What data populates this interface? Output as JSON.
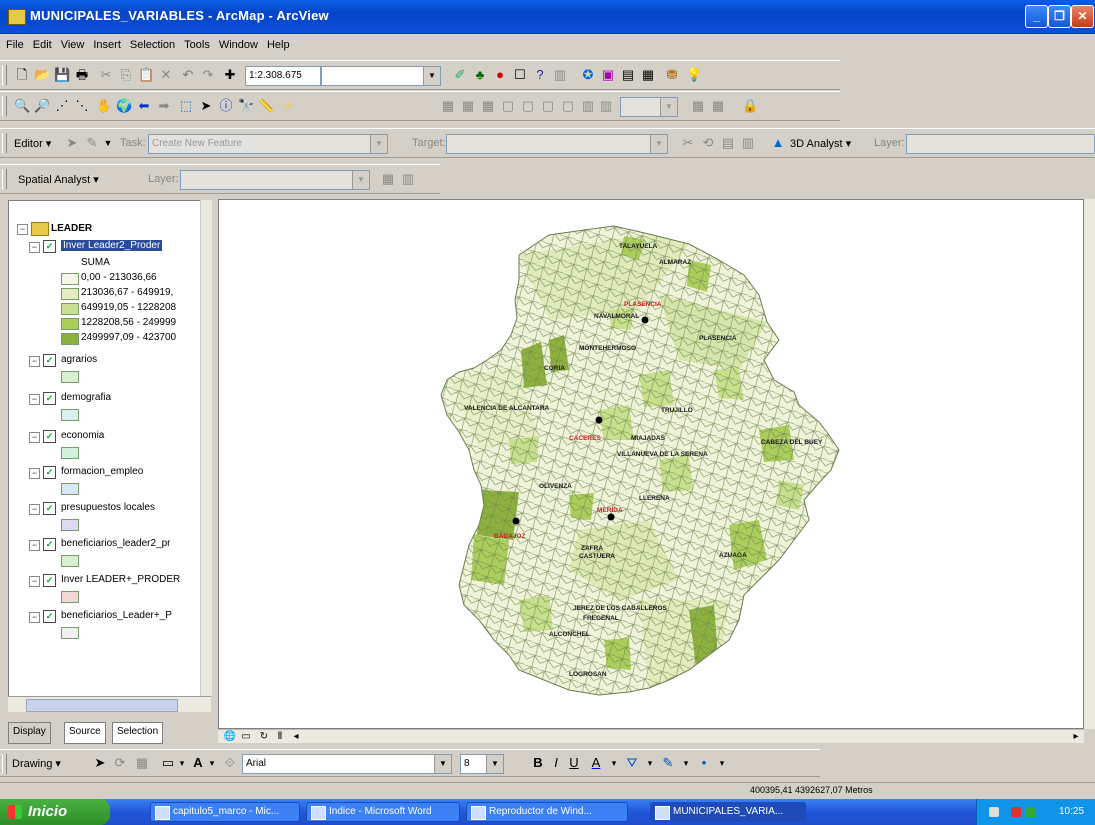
{
  "window": {
    "title": "MUNICIPALES_VARIABLES - ArcMap - ArcView"
  },
  "menu": [
    "File",
    "Edit",
    "View",
    "Insert",
    "Selection",
    "Tools",
    "Window",
    "Help"
  ],
  "toolbar": {
    "scale_value": "1:2.308.675"
  },
  "editor": {
    "editor_label": "Editor ▾",
    "task_label": "Task:",
    "task_value": "Create New Feature",
    "target_label": "Target:",
    "analyst_3d_label": "3D Analyst ▾",
    "layer_label": "Layer:"
  },
  "spatial_analyst": {
    "label": "Spatial Analyst ▾",
    "layer_label": "Layer:"
  },
  "toc": {
    "root": "LEADER",
    "layers": [
      {
        "name": "Inver Leader2_Proder",
        "selected": true,
        "field": "SUMA",
        "classes": [
          {
            "label": "0,00 - 213036,66",
            "color": "#f4f6e8"
          },
          {
            "label": "213036,67 - 649919,",
            "color": "#e3edc0"
          },
          {
            "label": "649919,05 - 1228208",
            "color": "#c8df8e"
          },
          {
            "label": "1228208,56 - 249999",
            "color": "#aacd5c"
          },
          {
            "label": "2499997,09 - 423700",
            "color": "#8db13e"
          }
        ]
      },
      {
        "name": "agrarios",
        "swatch": "#d8f0d0"
      },
      {
        "name": "demografia",
        "swatch": "#d8f0f0"
      },
      {
        "name": "economia",
        "swatch": "#d0f0e0"
      },
      {
        "name": "formacion_empleo",
        "swatch": "#d8e8f8"
      },
      {
        "name": "presupuestos locales",
        "swatch": "#e0d8f0"
      },
      {
        "name": "beneficiarios_leader2_pr",
        "swatch": "#d8f0d0"
      },
      {
        "name": "Inver LEADER+_PRODER",
        "swatch": "#f0d8d8"
      },
      {
        "name": "beneficiarios_Leader+_P",
        "swatch": "#f0f0f0"
      }
    ],
    "tabs": [
      "Display",
      "Source",
      "Selection"
    ]
  },
  "map": {
    "labels_black": [
      "ALMARAZ",
      "TALAYUELA",
      "PLASENCIA",
      "NAVALMORAL",
      "CORIA",
      "MONTEHERMOSO",
      "TRUJILLO",
      "LOGROSAN",
      "VILLANUEVA DE LA SERENA",
      "MIAJADAS",
      "ALCONCHEL",
      "LLERENA",
      "AZUAGA",
      "ZAFRA",
      "JEREZ DE LOS CABALLEROS",
      "FREGENAL",
      "OLIVENZA",
      "CASTUERA",
      "VALENCIA DE ALCANTARA",
      "CABEZA DEL BUEY"
    ],
    "labels_red": [
      "PLASENCIA",
      "CACERES",
      "BADAJOZ",
      "MERIDA"
    ]
  },
  "drawing": {
    "drawing_label": "Drawing ▾",
    "font_name": "Arial",
    "font_size": "8"
  },
  "status": {
    "coords": "400395,41  4392627,07 Metros"
  },
  "taskbar": {
    "start": "Inicio",
    "tasks": [
      "capitulo5_marco - Mic...",
      "Indice - Microsoft Word",
      "Reproductor de Wind...",
      "MUNICIPALES_VARIA..."
    ],
    "clock": "10:25"
  },
  "colors": {
    "titlebar": "#0645c6",
    "map_class_1": "#f4f6e8",
    "map_class_5": "#8db13e"
  }
}
